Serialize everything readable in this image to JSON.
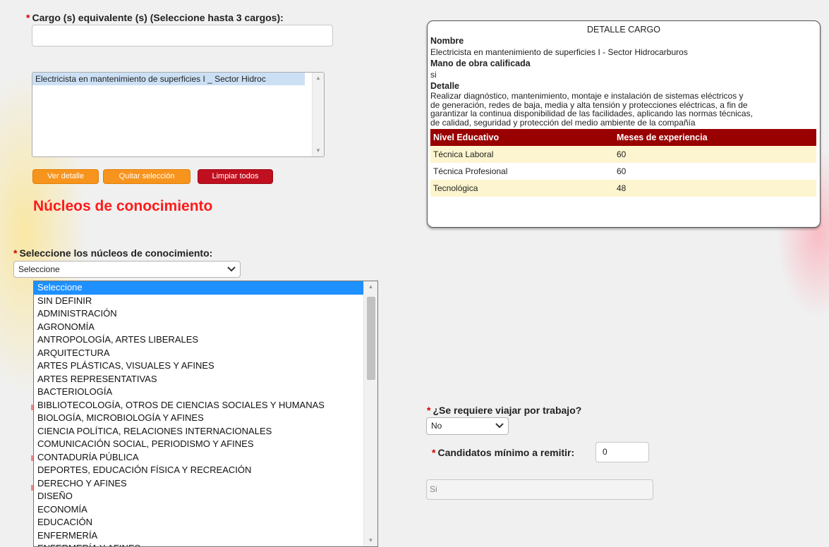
{
  "cargo": {
    "label": "Cargo (s) equivalente (s) (Seleccione hasta 3 cargos):",
    "input_value": "",
    "selected_items": [
      "Electricista en mantenimiento de superficies I _ Sector Hidroc"
    ]
  },
  "buttons": {
    "ver_detalle": "Ver detalle",
    "quitar_seleccion": "Quitar selección",
    "limpiar_todos": "Limpiar todos"
  },
  "nucleos": {
    "section_title": "Núcleos de conocimiento",
    "label": "Seleccione los núcleos de conocimiento:",
    "selected": "Seleccione",
    "options": [
      "Seleccione",
      "SIN DEFINIR",
      "ADMINISTRACIÓN",
      "AGRONOMÍA",
      "ANTROPOLOGÍA, ARTES LIBERALES",
      "ARQUITECTURA",
      "ARTES PLÁSTICAS, VISUALES Y AFINES",
      "ARTES REPRESENTATIVAS",
      "BACTERIOLOGÍA",
      "BIBLIOTECOLOGÍA, OTROS DE CIENCIAS SOCIALES Y HUMANAS",
      "BIOLOGÍA, MICROBIOLOGÍA Y AFINES",
      "CIENCIA POLÍTICA, RELACIONES INTERNACIONALES",
      "COMUNICACIÓN SOCIAL, PERIODISMO Y AFINES",
      "CONTADURÍA PÚBLICA",
      "DEPORTES, EDUCACIÓN FÍSICA Y RECREACIÓN",
      "DERECHO Y AFINES",
      "DISEÑO",
      "ECONOMÍA",
      "EDUCACIÓN",
      "ENFERMERÍA",
      "ENFERMERÍA Y AFINES"
    ]
  },
  "detalle": {
    "title": "DETALLE CARGO",
    "nombre_label": "Nombre",
    "nombre_value": "Electricista en mantenimiento de superficies I - Sector Hidrocarburos",
    "mano_label": "Mano de obra calificada",
    "mano_value": "si",
    "detalle_label": "Detalle",
    "detalle_lines": [
      "Realizar diagnóstico, mantenimiento, montaje e instalación de sistemas eléctricos y",
      "de generación, redes de baja, media y alta tensión y protecciones eléctricas, a fin de",
      "garantizar la continua disponibilidad de las facilidades, aplicando las normas técnicas,",
      "de calidad, seguridad y protección del medio ambiente de la compañía"
    ],
    "table": {
      "headers": [
        "Nivel Educativo",
        "Meses de experiencia"
      ],
      "rows": [
        [
          "Técnica Laboral",
          "60"
        ],
        [
          "Técnica Profesional",
          "60"
        ],
        [
          "Tecnológica",
          "48"
        ]
      ]
    }
  },
  "viajar": {
    "label": "¿Se requiere viajar por trabajo?",
    "value": "No"
  },
  "candidatos": {
    "label": "Candidatos mínimo a remitir:",
    "value": "0"
  },
  "extra_field": {
    "value": "Si"
  },
  "colors": {
    "required_asterisk": "#d40000",
    "button_orange": "#f7941d",
    "button_red": "#c00f1e",
    "section_title": "#ff1a1a",
    "table_header": "#990000",
    "table_row_alt": "#fdf5cf",
    "dropdown_selected": "#1e90ff"
  }
}
